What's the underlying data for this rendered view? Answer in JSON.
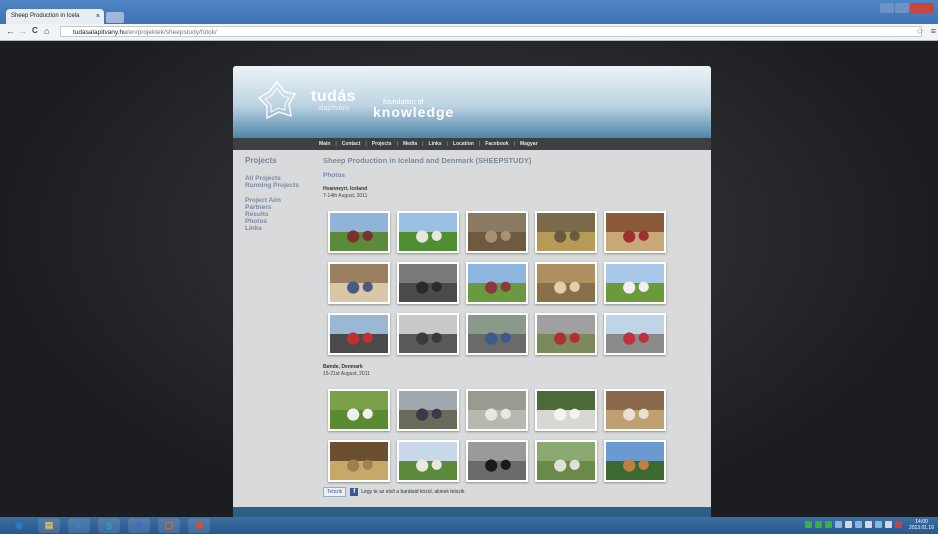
{
  "browser": {
    "tab_title": "Sheep Production in Icela",
    "tab_close": "×",
    "url_domain": "tudasalapitvany.hu",
    "url_path": "/en/projektek/sheepstudy/fotok/",
    "back": "←",
    "forward": "→",
    "reload": "C",
    "home": "⌂",
    "star": "☆",
    "menu": "≡"
  },
  "site": {
    "brand_main": "tudás",
    "brand_sub": "alapítvány",
    "brand_foundation": "foundation of",
    "brand_knowledge": "knowledge",
    "nav": [
      "Main",
      "Contact",
      "Projects",
      "Media",
      "Links",
      "Location",
      "Facebook",
      "Magyar"
    ],
    "sidebar": {
      "title": "Projects",
      "group1": [
        "All Projects",
        "Running Projects"
      ],
      "group2": [
        "Project Aim",
        "Partners",
        "Results",
        "Photos",
        "Links"
      ]
    },
    "heading": "Sheep Production in Iceland and Denmark (SHEEPSTUDY)",
    "subheading": "Photos",
    "section1": {
      "location": "Hvanneyri, Iceland",
      "date": "7-14th August, 2011"
    },
    "section2": {
      "location": "Bønde, Denmark",
      "date": "15-21st August, 2011"
    },
    "fb_like": "Tetszik",
    "fb_text": "Légy te az első a barátaid közül, akinek tetszik."
  },
  "gallery1": [
    {
      "sky": "#8fb4d8",
      "ground": "#5a8a3a",
      "fig": "#7a3030"
    },
    {
      "sky": "#9cc0e4",
      "ground": "#4f8f32",
      "fig": "#e8e6e0"
    },
    {
      "sky": "#8a7a62",
      "ground": "#6e5a40",
      "fig": "#a89070"
    },
    {
      "sky": "#7a6a4a",
      "ground": "#b89a58",
      "fig": "#6a5a40"
    },
    {
      "sky": "#8a5a3a",
      "ground": "#c8a878",
      "fig": "#a03030"
    },
    {
      "sky": "#9a8060",
      "ground": "#d8c8a8",
      "fig": "#4a5a7a"
    },
    {
      "sky": "#7a7a7a",
      "ground": "#4a4a4a",
      "fig": "#2a2a2a"
    },
    {
      "sky": "#8cb6e0",
      "ground": "#6a9a40",
      "fig": "#8a3a3a"
    },
    {
      "sky": "#b09060",
      "ground": "#8a7048",
      "fig": "#e0d0b0"
    },
    {
      "sky": "#a8c8e8",
      "ground": "#6a9a3a",
      "fig": "#f0f0f0"
    },
    {
      "sky": "#9ab8d4",
      "ground": "#4a4a4a",
      "fig": "#c03030"
    },
    {
      "sky": "#c8c8c8",
      "ground": "#5a5a5a",
      "fig": "#3a3a3a"
    },
    {
      "sky": "#8a9a8a",
      "ground": "#6a6a6a",
      "fig": "#3a5a8a"
    },
    {
      "sky": "#a0a0a0",
      "ground": "#7a8a5a",
      "fig": "#b03030"
    },
    {
      "sky": "#c0d4e8",
      "ground": "#8a8a8a",
      "fig": "#c03040"
    }
  ],
  "gallery2": [
    {
      "sky": "#7aa04a",
      "ground": "#5a8a32",
      "fig": "#f0f0f0"
    },
    {
      "sky": "#a0a8b0",
      "ground": "#6a6a5a",
      "fig": "#3a3a4a"
    },
    {
      "sky": "#9a9a90",
      "ground": "#b8b8b0",
      "fig": "#e8e8e0"
    },
    {
      "sky": "#4a6a3a",
      "ground": "#d8d8d0",
      "fig": "#f4f4f0"
    },
    {
      "sky": "#8a6a4a",
      "ground": "#c0a070",
      "fig": "#e8e0d0"
    },
    {
      "sky": "#6a5030",
      "ground": "#c8a868",
      "fig": "#a08050"
    },
    {
      "sky": "#c8d8e8",
      "ground": "#5a8a3a",
      "fig": "#e8e8e0"
    },
    {
      "sky": "#9a9a9a",
      "ground": "#6a6a6a",
      "fig": "#1a1a1a"
    },
    {
      "sky": "#8aa870",
      "ground": "#6a8a4a",
      "fig": "#e0e0d8"
    },
    {
      "sky": "#6a9ad0",
      "ground": "#3a6a30",
      "fig": "#c08040"
    }
  ],
  "taskbar": {
    "icons": [
      "◉",
      "▤",
      "e",
      "S",
      "◎",
      "▢",
      "◉"
    ],
    "clock_time": "14:00",
    "clock_date": "2013.01.16"
  }
}
